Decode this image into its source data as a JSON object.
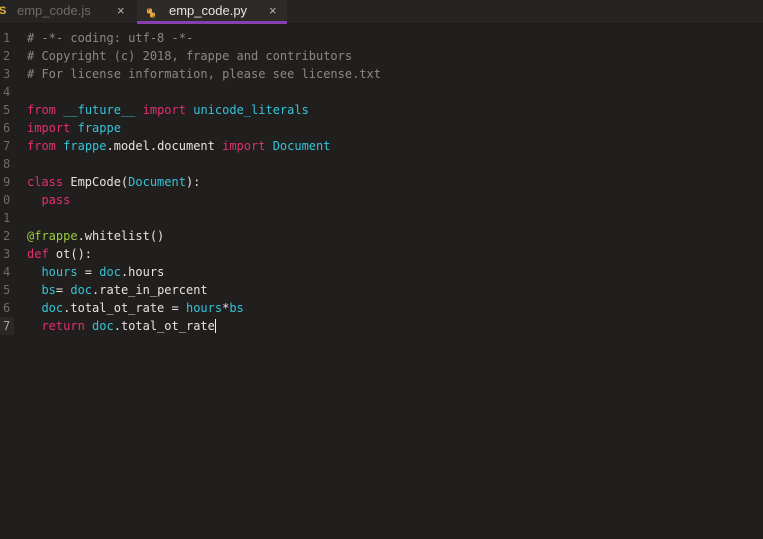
{
  "tabs": [
    {
      "icon": "S",
      "label": "emp_code.js",
      "close": "×",
      "active": false
    },
    {
      "icon": "python-icon",
      "label": "emp_code.py",
      "close": "×",
      "active": true
    }
  ],
  "colors": {
    "background": "#211f1e",
    "comment": "#8d8782",
    "keyword": "#e0306c",
    "name": "#35c3d8",
    "decorator": "#9ccc3a",
    "active_tab_accent": "#8a3fb0"
  },
  "editor": {
    "line_numbers": [
      "1",
      "2",
      "3",
      "4",
      "5",
      "6",
      "7",
      "8",
      "9",
      "0",
      "1",
      "2",
      "3",
      "4",
      "5",
      "6",
      "7"
    ],
    "active_line": 17,
    "lines": [
      [
        {
          "t": "c",
          "s": "# -*- coding: utf-8 -*-"
        }
      ],
      [
        {
          "t": "c",
          "s": "# Copyright (c) 2018, frappe and contributors"
        }
      ],
      [
        {
          "t": "c",
          "s": "# For license information, please see license.txt"
        }
      ],
      [],
      [
        {
          "t": "k",
          "s": "from"
        },
        {
          "t": "p",
          "s": " "
        },
        {
          "t": "n",
          "s": "__future__"
        },
        {
          "t": "p",
          "s": " "
        },
        {
          "t": "k",
          "s": "import"
        },
        {
          "t": "p",
          "s": " "
        },
        {
          "t": "n",
          "s": "unicode_literals"
        }
      ],
      [
        {
          "t": "k",
          "s": "import"
        },
        {
          "t": "p",
          "s": " "
        },
        {
          "t": "n",
          "s": "frappe"
        }
      ],
      [
        {
          "t": "k",
          "s": "from"
        },
        {
          "t": "p",
          "s": " "
        },
        {
          "t": "n",
          "s": "frappe"
        },
        {
          "t": "p",
          "s": ".model.document "
        },
        {
          "t": "k",
          "s": "import"
        },
        {
          "t": "p",
          "s": " "
        },
        {
          "t": "n",
          "s": "Document"
        }
      ],
      [],
      [
        {
          "t": "k",
          "s": "class"
        },
        {
          "t": "p",
          "s": " EmpCode("
        },
        {
          "t": "n",
          "s": "Document"
        },
        {
          "t": "p",
          "s": "):"
        }
      ],
      [
        {
          "t": "p",
          "s": "  "
        },
        {
          "t": "k",
          "s": "pass"
        }
      ],
      [],
      [
        {
          "t": "d",
          "s": "@frappe"
        },
        {
          "t": "p",
          "s": ".whitelist()"
        }
      ],
      [
        {
          "t": "k",
          "s": "def"
        },
        {
          "t": "p",
          "s": " ot():"
        }
      ],
      [
        {
          "t": "p",
          "s": "  "
        },
        {
          "t": "n",
          "s": "hours"
        },
        {
          "t": "p",
          "s": " = "
        },
        {
          "t": "n",
          "s": "doc"
        },
        {
          "t": "p",
          "s": ".hours"
        }
      ],
      [
        {
          "t": "p",
          "s": "  "
        },
        {
          "t": "n",
          "s": "bs"
        },
        {
          "t": "p",
          "s": "= "
        },
        {
          "t": "n",
          "s": "doc"
        },
        {
          "t": "p",
          "s": ".rate_in_percent"
        }
      ],
      [
        {
          "t": "p",
          "s": "  "
        },
        {
          "t": "n",
          "s": "doc"
        },
        {
          "t": "p",
          "s": ".total_ot_rate = "
        },
        {
          "t": "n",
          "s": "hours"
        },
        {
          "t": "p",
          "s": "*"
        },
        {
          "t": "n",
          "s": "bs"
        }
      ],
      [
        {
          "t": "p",
          "s": "  "
        },
        {
          "t": "k",
          "s": "return"
        },
        {
          "t": "p",
          "s": " "
        },
        {
          "t": "n",
          "s": "doc"
        },
        {
          "t": "p",
          "s": ".total_ot_rate"
        }
      ]
    ]
  }
}
